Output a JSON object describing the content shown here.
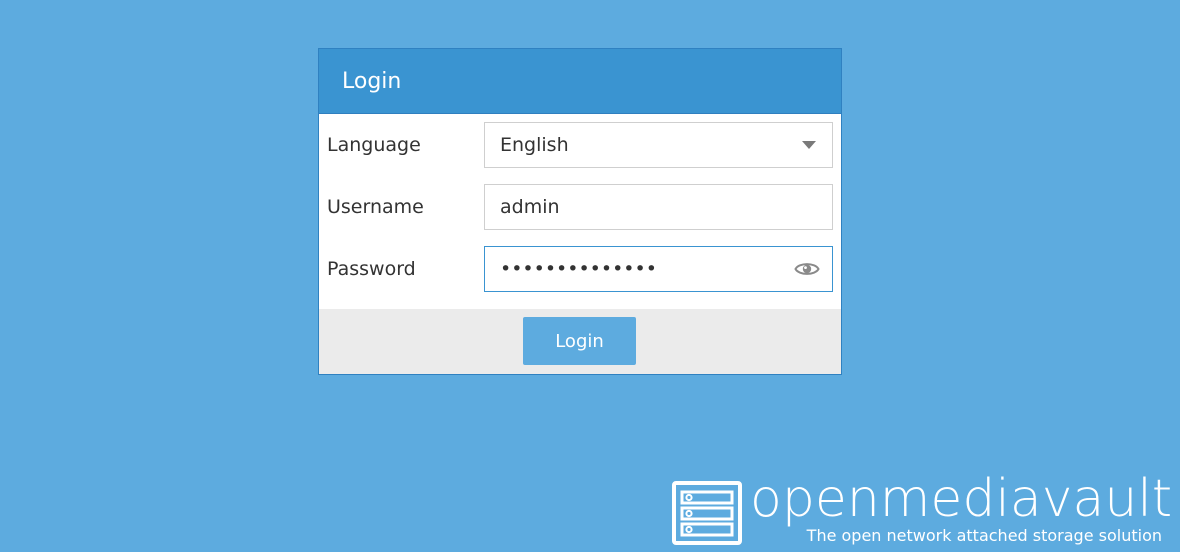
{
  "login": {
    "title": "Login",
    "language_label": "Language",
    "language_value": "English",
    "username_label": "Username",
    "username_value": "admin",
    "password_label": "Password",
    "password_masked": "••••••••••••••",
    "submit_label": "Login"
  },
  "branding": {
    "name": "openmediavault",
    "tagline": "The open network attached storage solution"
  },
  "icons": {
    "dropdown": "chevron-down-icon",
    "password_toggle": "eye-icon",
    "logo": "server-rack-icon"
  },
  "colors": {
    "background": "#5dabdf",
    "header": "#3a94d1",
    "button": "#5dabdf",
    "footer_bar": "#ebebeb"
  }
}
